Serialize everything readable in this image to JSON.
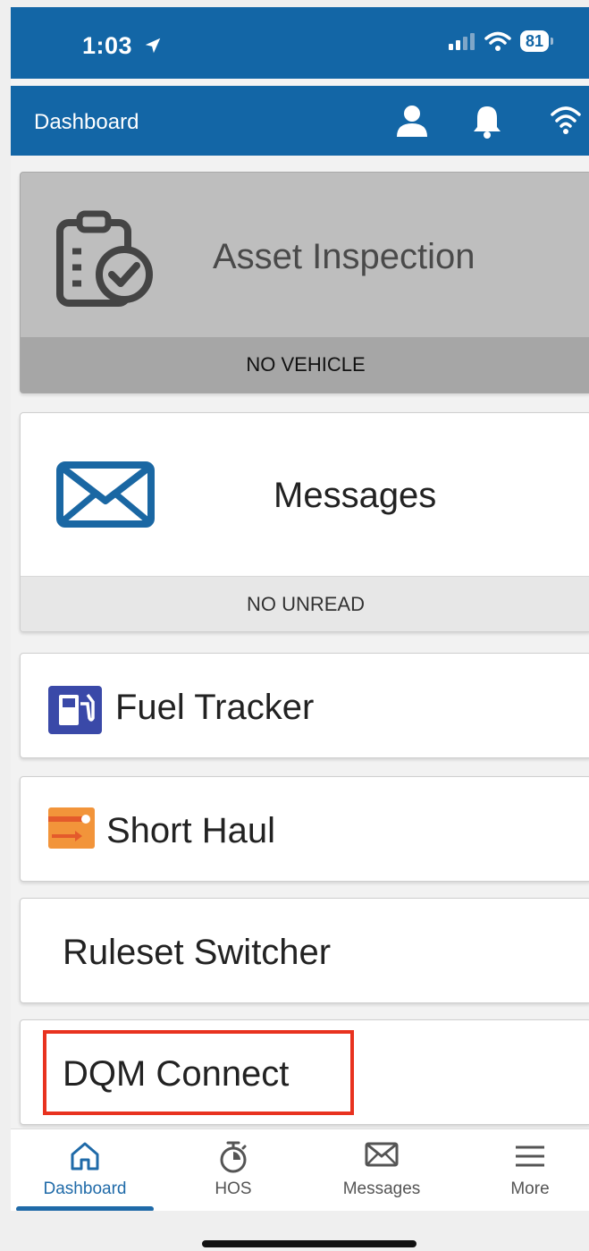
{
  "status_bar": {
    "time": "1:03",
    "battery": "81"
  },
  "header": {
    "title": "Dashboard"
  },
  "cards": {
    "asset_inspection": {
      "title": "Asset Inspection",
      "footer": "NO VEHICLE"
    },
    "messages": {
      "title": "Messages",
      "footer": "NO UNREAD"
    },
    "fuel_tracker": {
      "label": "Fuel Tracker"
    },
    "short_haul": {
      "label": "Short Haul"
    },
    "ruleset_switcher": {
      "label": "Ruleset Switcher"
    },
    "dqm_connect": {
      "label": "DQM Connect"
    }
  },
  "tabs": [
    {
      "label": "Dashboard",
      "icon": "home-icon",
      "active": true
    },
    {
      "label": "HOS",
      "icon": "stopwatch-icon",
      "active": false
    },
    {
      "label": "Messages",
      "icon": "envelope-icon",
      "active": false
    },
    {
      "label": "More",
      "icon": "menu-icon",
      "active": false
    }
  ],
  "colors": {
    "brand_blue": "#1366a6",
    "active_tab": "#1f6aa8",
    "highlight": "#e8321f"
  }
}
